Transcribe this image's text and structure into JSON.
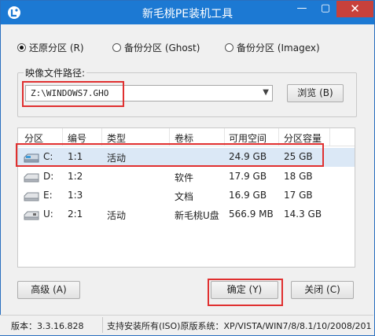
{
  "window": {
    "title": "新毛桃PE装机工具",
    "min_glyph": "—",
    "max_glyph": "▢",
    "close_glyph": "✕"
  },
  "mode": {
    "options": [
      {
        "label": "还原分区 (R)",
        "selected": true
      },
      {
        "label": "备份分区 (Ghost)",
        "selected": false
      },
      {
        "label": "备份分区 (Imagex)",
        "selected": false
      }
    ]
  },
  "image_path": {
    "label": "映像文件路径:",
    "value": "Z:\\WINDOWS7.GHO",
    "browse_label": "浏览 (B)"
  },
  "table": {
    "headers": [
      "分区",
      "编号",
      "类型",
      "卷标",
      "可用空间",
      "分区容量"
    ],
    "rows": [
      {
        "drive": "C:",
        "num": "1:1",
        "type": "活动",
        "label": "",
        "free": "24.9 GB",
        "size": "25 GB",
        "icon": "system-drive-icon",
        "selected": true
      },
      {
        "drive": "D:",
        "num": "1:2",
        "type": "",
        "label": "软件",
        "free": "17.9 GB",
        "size": "18 GB",
        "icon": "hard-drive-icon",
        "selected": false
      },
      {
        "drive": "E:",
        "num": "1:3",
        "type": "",
        "label": "文档",
        "free": "16.9 GB",
        "size": "17 GB",
        "icon": "hard-drive-icon",
        "selected": false
      },
      {
        "drive": "U:",
        "num": "2:1",
        "type": "活动",
        "label": "新毛桃U盘",
        "free": "566.9 MB",
        "size": "14.3 GB",
        "icon": "usb-drive-icon",
        "selected": false
      }
    ]
  },
  "buttons": {
    "advanced": "高级 (A)",
    "ok": "确定 (Y)",
    "close": "关闭 (C)"
  },
  "status": {
    "version": "版本：3.3.16.828",
    "support": "支持安装所有(ISO)原版系统：XP/VISTA/WIN7/8/8.1/10/2008/2012"
  },
  "colors": {
    "titlebar": "#1c79d3",
    "close": "#c7413b",
    "highlight": "#e03030",
    "selected_row": "#dbe8f6"
  }
}
